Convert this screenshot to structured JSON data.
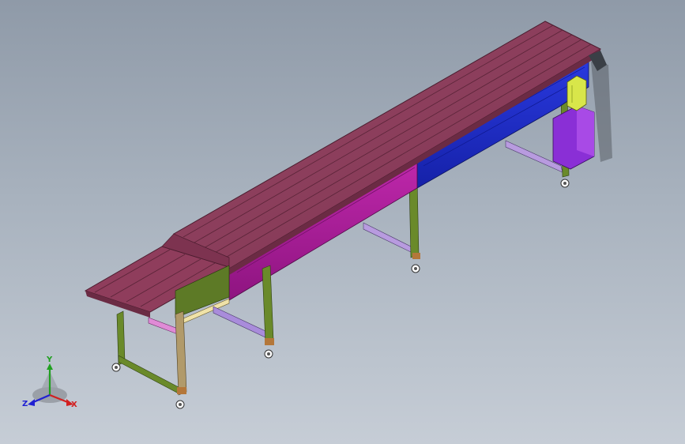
{
  "app": {
    "title": "",
    "model": "belt-conveyor-assembly"
  },
  "colors": {
    "background_top": "#8f9aa8",
    "background_bottom": "#c6cdd6",
    "belt": "#8f3d5c",
    "belt_edge": "#5a2438",
    "frame_magenta": "#b01c9e",
    "frame_blue": "#1f2fd1",
    "legs_olive": "#6a8a2a",
    "leg_wood": "#b19a6a",
    "crossbar_lavender": "#a98cdb",
    "crossbar_pink": "#e08bd6",
    "motor_purple": "#8a2fd6",
    "gearbox_yellow": "#d8e64a",
    "axis_x": "#d22020",
    "axis_y": "#20a020",
    "axis_z": "#2020d2"
  },
  "triad": {
    "x_label": "X",
    "y_label": "Y",
    "z_label": "Z",
    "x_icon": "axis-x-arrow-icon",
    "y_icon": "axis-y-arrow-icon",
    "z_icon": "axis-z-arrow-icon"
  }
}
